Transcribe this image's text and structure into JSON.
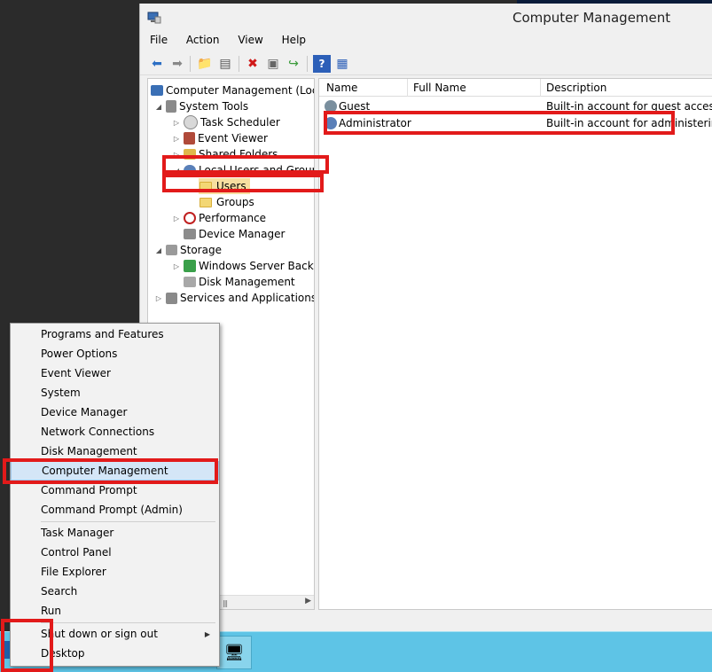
{
  "window": {
    "title": "Computer Management",
    "menu": [
      "File",
      "Action",
      "View",
      "Help"
    ]
  },
  "tree": {
    "root": "Computer Management (Local",
    "system_tools": "System Tools",
    "task_scheduler": "Task Scheduler",
    "event_viewer": "Event Viewer",
    "shared_folders": "Shared Folders",
    "local_users_groups": "Local Users and Groups",
    "users": "Users",
    "groups": "Groups",
    "performance": "Performance",
    "device_manager": "Device Manager",
    "storage": "Storage",
    "windows_server_backup": "Windows Server Backup",
    "disk_management": "Disk Management",
    "services_apps": "Services and Applications"
  },
  "list": {
    "columns": [
      "Name",
      "Full Name",
      "Description"
    ],
    "rows": [
      {
        "name": "Guest",
        "full_name": "",
        "description": "Built-in account for guest access t..."
      },
      {
        "name": "Administrator",
        "full_name": "",
        "description": "Built-in account for administering..."
      }
    ]
  },
  "context_menu": {
    "items": [
      "Programs and Features",
      "Power Options",
      "Event Viewer",
      "System",
      "Device Manager",
      "Network Connections",
      "Disk Management",
      "Computer Management",
      "Command Prompt",
      "Command Prompt (Admin)",
      "Task Manager",
      "Control Panel",
      "File Explorer",
      "Search",
      "Run",
      "Shut down or sign out",
      "Desktop"
    ],
    "highlighted": "Computer Management"
  },
  "colors": {
    "annotation": "#e21a1a",
    "taskbar": "#5ec4e6",
    "selection": "#d4e6f7"
  }
}
